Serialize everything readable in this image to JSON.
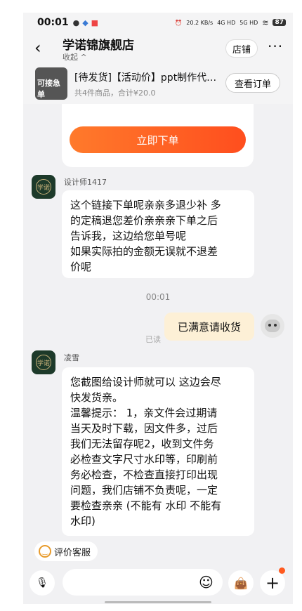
{
  "status_bar": {
    "time": "00:01",
    "network_speed": "20.2 KB/s",
    "signal1": "4G HD",
    "signal2": "5G HD",
    "battery": "87",
    "icons": [
      "chat-bubble-icon",
      "app-icon",
      "mail-icon",
      "alarm-icon",
      "wifi-icon"
    ]
  },
  "header": {
    "title": "学诺锦旗舰店",
    "collapse_label": "收起 ^",
    "shop_button": "店铺",
    "more_label": "···"
  },
  "order": {
    "thumbnail_text": "可接急单",
    "title": "[待发货]【活动价】ppt制作代…",
    "summary": "共4件商品，合计¥20.0",
    "view_button": "查看订单",
    "place_order_button": "立即下单"
  },
  "messages": [
    {
      "sender": "设计师1417",
      "avatar_text": "学诺",
      "lines": [
        "这个链接下单呢亲亲多退少补 多",
        "的定稿退您差价亲亲亲下单之后",
        "告诉我，这边给您单号呢",
        "如果实际拍的金额无误就不退差",
        "价呢"
      ]
    },
    {
      "timestamp": "00:01"
    },
    {
      "self": true,
      "text": "已满意请收货",
      "read_status": "已读"
    },
    {
      "sender": "凌雪",
      "avatar_text": "学诺",
      "lines": [
        "您截图给设计师就可以  这边会尽",
        "快发货亲。",
        "温馨提示：  1，亲文件会过期请",
        "当天及时下载，因文件多，过后",
        "我们无法留存呢2，收到文件务",
        "必检查文字尺寸水印等，印刷前",
        "务必检查，不检查直接打印出现",
        "问题，我们店铺不负责呢，一定",
        "要检查亲亲 (不能有  水印  不能有",
        "水印)"
      ]
    }
  ],
  "footer": {
    "rate_button": "评价客服",
    "input_placeholder": ""
  },
  "colors": {
    "accent_orange": "#ff5a1f",
    "self_bubble": "#fdf0d6",
    "background": "#f1f1f3"
  }
}
